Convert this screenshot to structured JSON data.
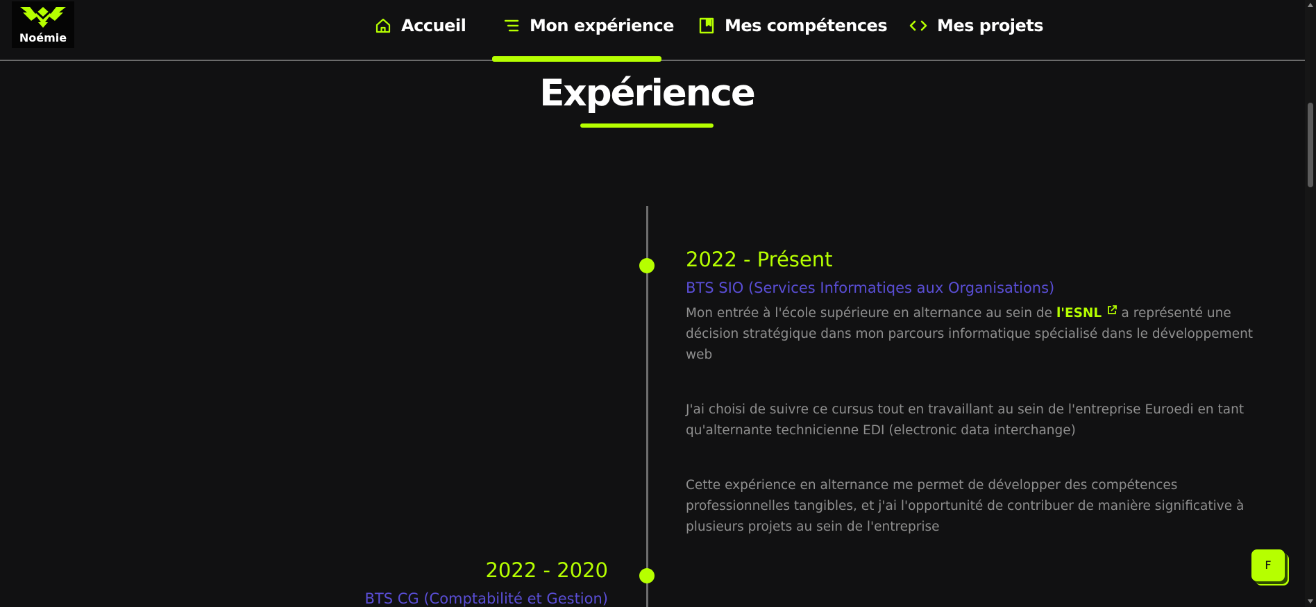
{
  "logo": {
    "name": "Noémie"
  },
  "nav": {
    "items": [
      {
        "label": "Accueil",
        "icon": "home-icon"
      },
      {
        "label": "Mon expérience",
        "icon": "list-icon"
      },
      {
        "label": "Mes compétences",
        "icon": "book-icon"
      },
      {
        "label": "Mes projets",
        "icon": "code-icon"
      }
    ],
    "active": "Mon expérience"
  },
  "page": {
    "title": "Expérience"
  },
  "timeline": [
    {
      "year": "2022 - Présent",
      "degree": "BTS SIO (Services Informatiqes aux Organisations)",
      "p1_before": "Mon entrée à l'école supérieure en alternance au sein de ",
      "p1_link": "l'ESNL",
      "p1_after": " a représenté une décision stratégique dans mon parcours informatique spécialisé dans le développement web",
      "p2": "J'ai choisi de suivre ce cursus tout en travaillant au sein de l'entreprise Euroedi en tant qu'alternante technicienne EDI (electronic data interchange)",
      "p3": "Cette expérience en alternance me permet de développer des compétences professionnelles tangibles, et j'ai l'opportunité de contribuer de manière significative à plusieurs projets au sein de l'entreprise"
    },
    {
      "year": "2022 - 2020",
      "degree": "BTS CG (Comptabilité et Gestion)"
    }
  ],
  "fab": {
    "label": "F"
  },
  "colors": {
    "accent": "#b6ff00",
    "degree": "#5a4ed6",
    "background": "#111112",
    "text_muted": "#8f8f8f"
  }
}
